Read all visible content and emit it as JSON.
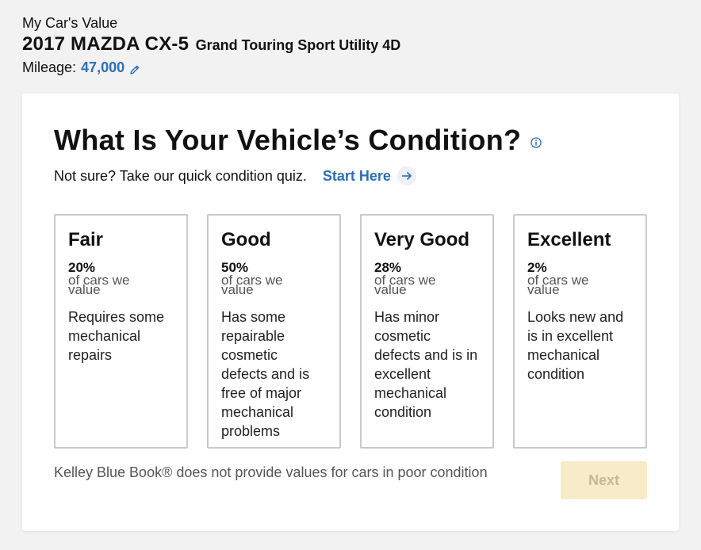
{
  "header": {
    "kicker": "My Car's Value",
    "year_make_model": "2017 MAZDA CX-5",
    "trim": "Grand Touring Sport Utility 4D",
    "mileage_label": "Mileage:",
    "mileage_value": "47,000",
    "edit_icon": "pencil-icon"
  },
  "card": {
    "title": "What Is Your Vehicle’s Condition?",
    "info_icon": "info-icon",
    "quiz_text": "Not sure? Take our quick condition quiz.",
    "start_link": "Start Here",
    "arrow_icon": "arrow-right-icon",
    "options": [
      {
        "name": "Fair",
        "pct": "20%",
        "sub": "of cars we value",
        "desc": "Requires some mechanical repairs"
      },
      {
        "name": "Good",
        "pct": "50%",
        "sub": "of cars we value",
        "desc": "Has some repairable cosmetic defects and is free of major mechanical problems"
      },
      {
        "name": "Very Good",
        "pct": "28%",
        "sub": "of cars we value",
        "desc": "Has minor cosmetic defects and is in excellent mechanical condition"
      },
      {
        "name": "Excellent",
        "pct": "2%",
        "sub": "of cars we value",
        "desc": "Looks new and is in excellent mechanical condition"
      }
    ],
    "disclaimer": "Kelley Blue Book® does not provide values for cars in poor condition",
    "next_label": "Next"
  },
  "colors": {
    "link": "#2c6fb8",
    "next_bg_disabled": "#f7ecc7",
    "card_border": "#c9c9c9"
  }
}
